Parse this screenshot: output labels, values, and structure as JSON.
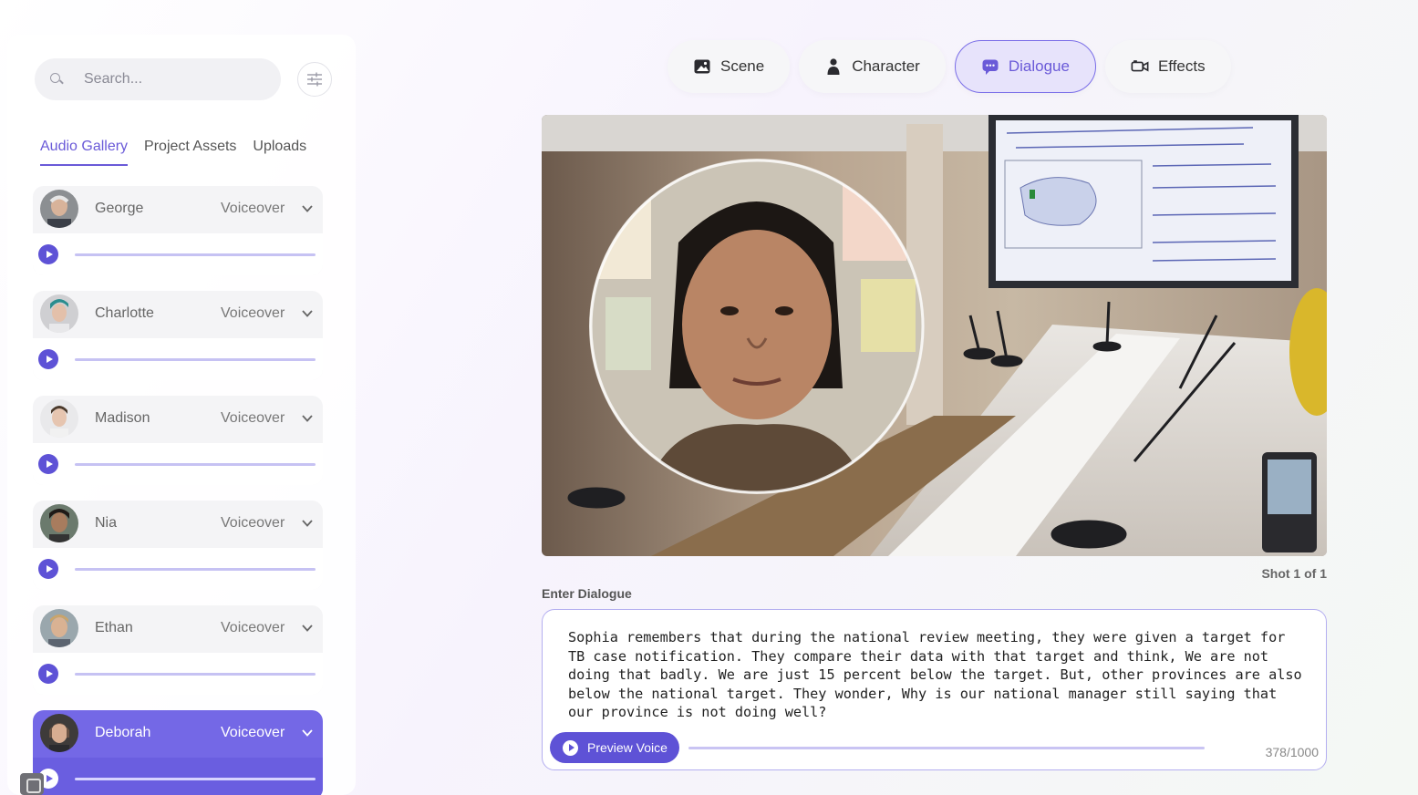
{
  "search": {
    "placeholder": "Search..."
  },
  "tabs": [
    {
      "label": "Audio Gallery",
      "active": true
    },
    {
      "label": "Project Assets",
      "active": false
    },
    {
      "label": "Uploads",
      "active": false
    }
  ],
  "voices": [
    {
      "name": "George",
      "type": "Voiceover",
      "selected": false
    },
    {
      "name": "Charlotte",
      "type": "Voiceover",
      "selected": false
    },
    {
      "name": "Madison",
      "type": "Voiceover",
      "selected": false
    },
    {
      "name": "Nia",
      "type": "Voiceover",
      "selected": false
    },
    {
      "name": "Ethan",
      "type": "Voiceover",
      "selected": false
    },
    {
      "name": "Deborah",
      "type": "Voiceover",
      "selected": true
    }
  ],
  "nav": [
    {
      "label": "Scene",
      "icon": "image-icon",
      "active": false
    },
    {
      "label": "Character",
      "icon": "person-icon",
      "active": false
    },
    {
      "label": "Dialogue",
      "icon": "chat-icon",
      "active": true
    },
    {
      "label": "Effects",
      "icon": "camera-icon",
      "active": false
    }
  ],
  "shot": {
    "label": "Shot 1 of 1"
  },
  "dialogue": {
    "label": "Enter Dialogue",
    "text": "Sophia remembers that during the national review meeting, they were given a target for TB case notification. They compare their data with that target and think, We are not doing that badly. We are just 15 percent below the target. But, other provinces are also below the national target. They wonder, Why is our national manager still saying that our province is not doing well?",
    "preview_label": "Preview Voice",
    "count": "378/1000"
  },
  "colors": {
    "accent": "#5e52d6",
    "selected_card": "#7468e6",
    "active_nav_bg": "#e7e3fb"
  }
}
